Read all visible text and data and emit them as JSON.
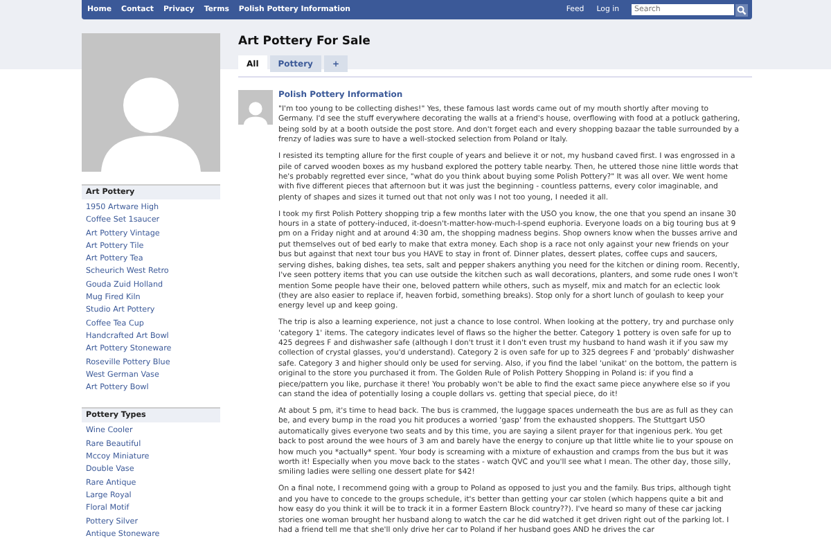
{
  "nav": {
    "links": [
      "Home",
      "Contact",
      "Privacy",
      "Terms",
      "Polish Pottery Information"
    ],
    "right_links": [
      "Feed",
      "Log in"
    ],
    "search": {
      "placeholder": "Search"
    }
  },
  "page_title": "Art Pottery For Sale",
  "tabs": [
    {
      "label": "All",
      "selected": true
    },
    {
      "label": "Pottery",
      "selected": false
    },
    {
      "label": "+",
      "selected": false
    }
  ],
  "sidebar": [
    {
      "title": "Art Pottery",
      "items": [
        "1950 Artware High",
        "Coffee Set 1saucer",
        "Art Pottery Vintage",
        "Art Pottery Tile",
        "Art Pottery Tea",
        "Scheurich West Retro",
        "Gouda Zuid Holland",
        "Mug Fired Kiln",
        "Studio Art Pottery",
        "Coffee Tea Cup",
        "Handcrafted Art Bowl",
        "Art Pottery Stoneware",
        "Roseville Pottery Blue",
        "West German Vase",
        "Art Pottery Bowl"
      ]
    },
    {
      "title": "Pottery Types",
      "items": [
        "Wine Cooler",
        "Rare Beautiful",
        "Mccoy Miniature",
        "Double Vase",
        "Rare Antique",
        "Large Royal",
        "Floral Motif",
        "Pottery Silver",
        "Antique Stoneware"
      ]
    }
  ],
  "post": {
    "title": "Polish Pottery Information",
    "paragraphs": [
      "\"I'm too young to be collecting dishes!\" Yes, these famous last words came out of my mouth shortly after moving to Germany. I'd see the stuff everywhere  decorating the walls at a friend's house, overflowing with food at a potluck gathering, being sold by at a booth outside the post store. And don't forget each and every shopping bazaar  the table surrounded by a frenzy of ladies was sure to have a well-stocked selection from Poland or Italy.",
      "I resisted its tempting allure for the first couple of years and believe it or not, my husband caved first. I was engrossed in a pile of carved wooden boxes as my husband explored the pottery table nearby. Then, he uttered those nine little words that he's probably regretted ever since, \"what do you think about buying some Polish Pottery?\" It was all over. We went home with five different pieces that afternoon but it was just the beginning - countless patterns, every color imaginable, and plenty of shapes and sizes  it turned out that not only was I not too young, I needed it all.",
      "I took my first Polish Pottery shopping trip a few months later with the USO  you know, the one that you spend an insane 30 hours in a state of pottery-induced, it-doesn't-matter-how-much-I-spend euphoria. Everyone loads on a big touring bus at 9 pm on a Friday night and at around 4:30 am, the shopping madness begins. Shop owners know when the busses arrive and put themselves out of bed early to make that extra money. Each shop is a race  not only against your new friends on your bus but against that next tour bus you HAVE to stay in front of. Dinner plates, dessert plates, coffee cups and saucers, serving dishes, baking dishes, tea sets, salt and pepper shakers  anything you need for the kitchen or dining room. Recently, I've seen pottery items that you can use outside the kitchen such as wall decorations, planters, and some rude ones I won't mention  Some people have their one, beloved pattern while others, such as myself, mix and match for an eclectic look (they are also easier to replace if, heaven forbid, something breaks). Stop only for a short lunch of goulash to keep your energy level up and keep going.",
      "The trip is also a learning experience, not just a chance to lose control. When looking at the pottery, try and purchase only 'category 1' items. The category indicates level of flaws so the higher the better. Category 1 pottery is oven safe for up to 425 degrees F and dishwasher safe (although I don't trust it  I don't even trust my husband to hand wash it if you saw my collection of crystal glasses, you'd understand). Category 2 is oven safe for up to 325 degrees F and 'probably' dishwasher safe. Category 3 and higher should only be used for serving. Also, if you find the label 'unikat' on the bottom, the pattern is original to the store you purchased it from. The Golden Rule of Polish Pottery Shopping in Poland is: if you find a piece/pattern you like, purchase it there! You probably won't be able to find the exact same piece anywhere else so if you can stand the idea of potentially losing a couple dollars vs. getting that special piece, do it!",
      "At about 5 pm, it's time to head back. The bus is crammed, the luggage spaces underneath the bus are as full as they can be, and every bump in the road you hit produces a worried 'gasp' from the exhausted shoppers. The Stuttgart USO automatically gives everyone two seats and by this time, you are saying a silent prayer for that ingenious perk. You get back to post around the wee hours of 3 am and barely have the energy to conjure up that little white lie to your spouse on how much you *actually* spent. Your body is screaming with a mixture of exhaustion and cramps from the bus but it was worth it! Especially when you move back to the states - watch QVC and you'll see what I mean. The other day, those silly, smiling ladies were selling one dessert plate for $42!",
      "On a final note, I recommend going with a group to Poland as opposed to just you and the family. Bus trips, although tight and you have to concede to the groups schedule, it's better than getting your car stolen (which happens quite a bit  and how easy do you think it will be to track it in a former Eastern Block country??). I've heard so many of these car jacking stories  one woman brought her husband along to watch the car  he did  watched it get driven right out of the parking lot. I had a friend tell me that she'll only drive her car to Poland if her husband goes AND he drives the car"
    ]
  }
}
